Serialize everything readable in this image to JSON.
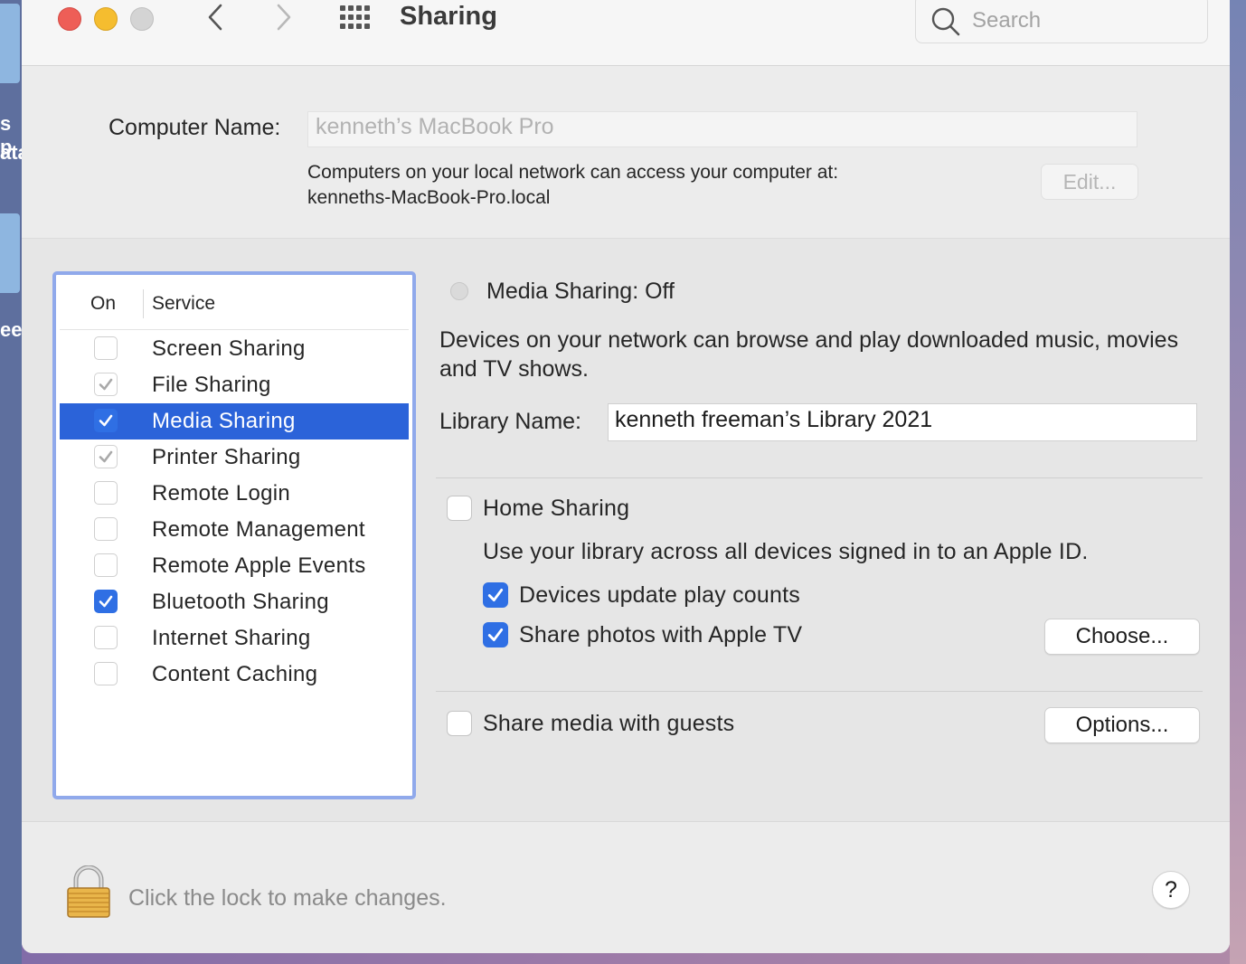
{
  "desktop": {
    "left_text_1": "s p",
    "left_text_2": "ata",
    "left_text_3": "ee"
  },
  "window": {
    "title": "Sharing",
    "search_placeholder": "Search"
  },
  "computer_name": {
    "label": "Computer Name:",
    "value": "kenneth’s MacBook Pro",
    "note_line1": "Computers on your local network can access your computer at:",
    "note_line2": "kenneths-MacBook-Pro.local",
    "edit_label": "Edit..."
  },
  "services": {
    "header_on": "On",
    "header_service": "Service",
    "items": [
      {
        "label": "Screen Sharing",
        "checked": false,
        "style": "none"
      },
      {
        "label": "File Sharing",
        "checked": true,
        "style": "gray"
      },
      {
        "label": "Media Sharing",
        "checked": true,
        "style": "selected"
      },
      {
        "label": "Printer Sharing",
        "checked": true,
        "style": "gray"
      },
      {
        "label": "Remote Login",
        "checked": false,
        "style": "none"
      },
      {
        "label": "Remote Management",
        "checked": false,
        "style": "none"
      },
      {
        "label": "Remote Apple Events",
        "checked": false,
        "style": "none"
      },
      {
        "label": "Bluetooth Sharing",
        "checked": true,
        "style": "blue"
      },
      {
        "label": "Internet Sharing",
        "checked": false,
        "style": "none"
      },
      {
        "label": "Content Caching",
        "checked": false,
        "style": "none"
      }
    ]
  },
  "media_sharing": {
    "status": "Media Sharing: Off",
    "description": "Devices on your network can browse and play downloaded music, movies and TV shows.",
    "library_label": "Library Name:",
    "library_value": "kenneth freeman’s Library 2021",
    "home_sharing_label": "Home Sharing",
    "home_sharing_checked": false,
    "home_sharing_desc": "Use your library across all devices signed in to an Apple ID.",
    "play_counts_label": "Devices update play counts",
    "play_counts_checked": true,
    "share_photos_label": "Share photos with Apple TV",
    "share_photos_checked": true,
    "choose_label": "Choose...",
    "guests_label": "Share media with guests",
    "guests_checked": false,
    "options_label": "Options..."
  },
  "footer": {
    "lock_text": "Click the lock to make changes.",
    "help_label": "?"
  },
  "colors": {
    "accent": "#2f6fe4",
    "selection": "#2b63d9",
    "list_focus_ring": "#90a9eb"
  }
}
